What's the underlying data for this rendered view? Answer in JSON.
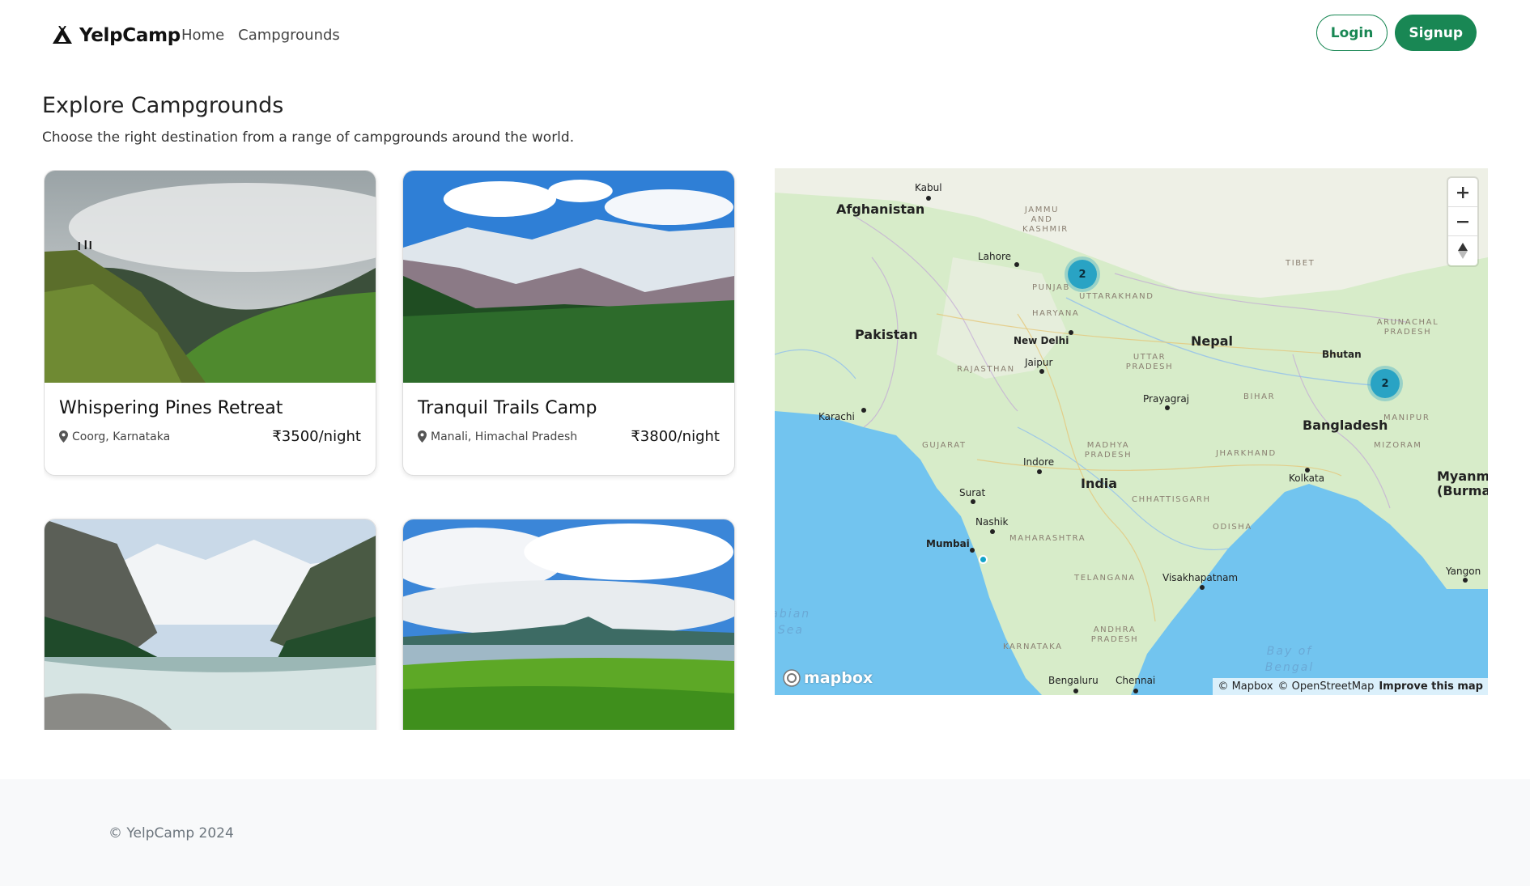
{
  "nav": {
    "brand": "YelpCamp",
    "links": [
      "Home",
      "Campgrounds"
    ],
    "login": "Login",
    "signup": "Signup"
  },
  "header": {
    "title": "Explore Campgrounds",
    "subtitle": "Choose the right destination from a range of campgrounds around the world."
  },
  "campgrounds": [
    {
      "name": "Whispering Pines Retreat",
      "location": "Coorg, Karnataka",
      "price": "₹3500/night"
    },
    {
      "name": "Tranquil Trails Camp",
      "location": "Manali, Himachal Pradesh",
      "price": "₹3800/night"
    },
    {
      "name": "",
      "location": "",
      "price": ""
    },
    {
      "name": "",
      "location": "",
      "price": ""
    }
  ],
  "map": {
    "countries": [
      "Afghanistan",
      "Pakistan",
      "Nepal",
      "Bhutan",
      "Bangladesh",
      "India",
      "Myanmar (Burma)"
    ],
    "cities": [
      "Kabul",
      "Lahore",
      "New Delhi",
      "Jaipur",
      "Prayagraj",
      "Karachi",
      "Indore",
      "Surat",
      "Nashik",
      "Mumbai",
      "Kolkata",
      "Visakhapatnam",
      "Yangon",
      "Bengaluru",
      "Chennai"
    ],
    "regions": [
      "Jammu and Kashmir",
      "Punjab",
      "Uttarakhand",
      "Haryana",
      "Rajasthan",
      "Uttar Pradesh",
      "Bihar",
      "Gujarat",
      "Madhya Pradesh",
      "Jharkhand",
      "Chhattisgarh",
      "Maharashtra",
      "Odisha",
      "Telangana",
      "Andhra Pradesh",
      "Karnataka",
      "Tibet",
      "Arunachal Pradesh",
      "Manipur",
      "Mizoram"
    ],
    "waters": [
      "Arabian Sea",
      "Bay of Bengal"
    ],
    "clusters": [
      2,
      2
    ],
    "attribution": {
      "mapbox": "© Mapbox",
      "osm": "© OpenStreetMap",
      "improve": "Improve this map"
    },
    "logo_text": "mapbox"
  },
  "footer": {
    "text": "© YelpCamp 2024"
  },
  "colors": {
    "primary": "#198754",
    "cluster": "#29a3c4",
    "footer_bg": "#f8f9fa"
  }
}
